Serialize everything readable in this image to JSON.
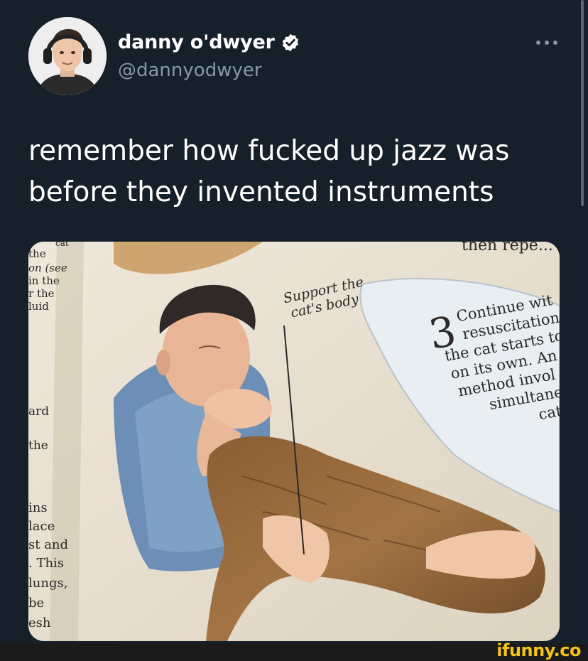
{
  "tweet": {
    "display_name": "danny o'dwyer",
    "handle": "@dannyodwyer",
    "verified": true,
    "text_line1": "remember how fucked up jazz was",
    "text_line2": "before they invented instruments",
    "more_icon": "more-horizontal-icon"
  },
  "media": {
    "caption": [
      "Support the",
      "cat's body"
    ],
    "step_number": "3",
    "step_text": [
      "Continue wit",
      "resuscitation",
      "the cat starts to",
      "on its own. An",
      "method invol",
      "simultaneo",
      "cat's"
    ],
    "top_text": "then repe...",
    "left_column": [
      "cat",
      "the",
      "on (see",
      "in the",
      "r the",
      "luid",
      "ard",
      "the",
      "ins",
      "lace",
      "st and",
      ". This",
      "lungs,",
      "be",
      "esh"
    ]
  },
  "watermark": "ifunny.co",
  "colors": {
    "background": "#15202b",
    "secondary_text": "#8899a6",
    "verified_blue": "#ffffff",
    "watermark_yellow": "#f3c316"
  }
}
